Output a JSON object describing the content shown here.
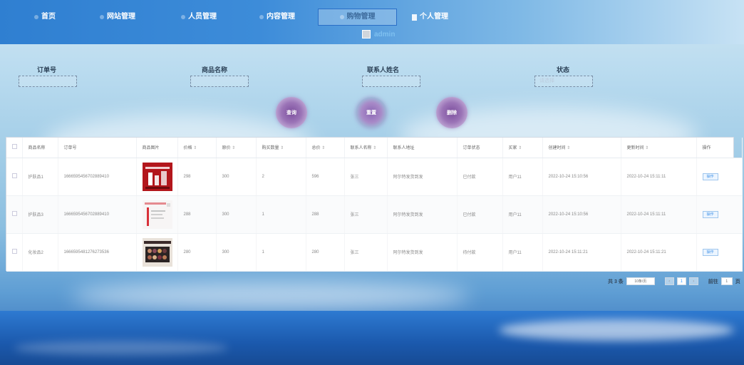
{
  "nav": {
    "items": [
      {
        "label": "首页",
        "icon": "dot-icon"
      },
      {
        "label": "网站管理",
        "icon": "dot-icon"
      },
      {
        "label": "人员管理",
        "icon": "dot-icon"
      },
      {
        "label": "内容管理",
        "icon": "dot-icon"
      },
      {
        "label": "购物管理",
        "icon": "dot-icon",
        "active": true
      },
      {
        "label": "个人管理",
        "icon": "doc-icon"
      }
    ],
    "user": "admin"
  },
  "filters": {
    "order_no": {
      "label": "订单号",
      "placeholder": ""
    },
    "product_name": {
      "label": "商品名称",
      "placeholder": ""
    },
    "contact_name": {
      "label": "联系人姓名",
      "placeholder": ""
    },
    "status": {
      "label": "状态",
      "placeholder": "请选择"
    }
  },
  "actions": {
    "query": "查询",
    "reset": "重置",
    "delete": "删除"
  },
  "table": {
    "columns": [
      "商品名称",
      "订单号",
      "商品图片",
      "价格",
      "原价",
      "购买数量",
      "总价",
      "联系人名称",
      "联系人地址",
      "订单状态",
      "买家",
      "创建时间",
      "更新时间",
      "操作"
    ],
    "sortable_suffix": "⇕",
    "rows": [
      {
        "name": "护肤品1",
        "order_no": "16665954567028894​10",
        "price": "298",
        "orig": "300",
        "qty": "2",
        "total": "596",
        "contact": "张三",
        "address": "阿尔特发货到发",
        "status": "已付款",
        "buyer": "用户11",
        "created": "2022-10-24 15:10:56",
        "updated": "2022-10-24 15:11:11",
        "op": "操作"
      },
      {
        "name": "护肤品3",
        "order_no": "1666595456702889410",
        "price": "288",
        "orig": "300",
        "qty": "1",
        "total": "288",
        "contact": "张三",
        "address": "阿尔特发货到发",
        "status": "已付款",
        "buyer": "用户11",
        "created": "2022-10-24 15:10:56",
        "updated": "2022-10-24 15:11:11",
        "op": "操作"
      },
      {
        "name": "化妆品2",
        "order_no": "1666595481276273536",
        "price": "280",
        "orig": "300",
        "qty": "1",
        "total": "280",
        "contact": "张三",
        "address": "阿尔特发货到发",
        "status": "待付款",
        "buyer": "用户11",
        "created": "2022-10-24 15:11:21",
        "updated": "2022-10-24 15:11:21",
        "op": "操作"
      }
    ]
  },
  "pagination": {
    "total": "共 3 条",
    "page_size": "10条/页",
    "current": "1",
    "goto": "前往",
    "goto_value": "1",
    "page_suffix": "页"
  },
  "colors": {
    "nav_blue": "#2f7fd1",
    "accent": "#409eff",
    "circle_purple": "#8a67b4"
  }
}
